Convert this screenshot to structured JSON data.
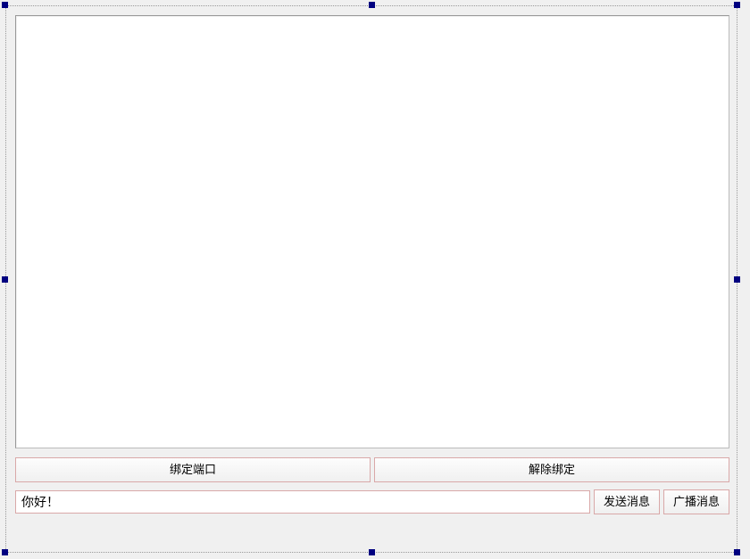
{
  "buttons": {
    "bind_port": "绑定端口",
    "unbind": "解除绑定",
    "send_message": "发送消息",
    "broadcast_message": "广播消息"
  },
  "input": {
    "message_value": "你好！"
  }
}
